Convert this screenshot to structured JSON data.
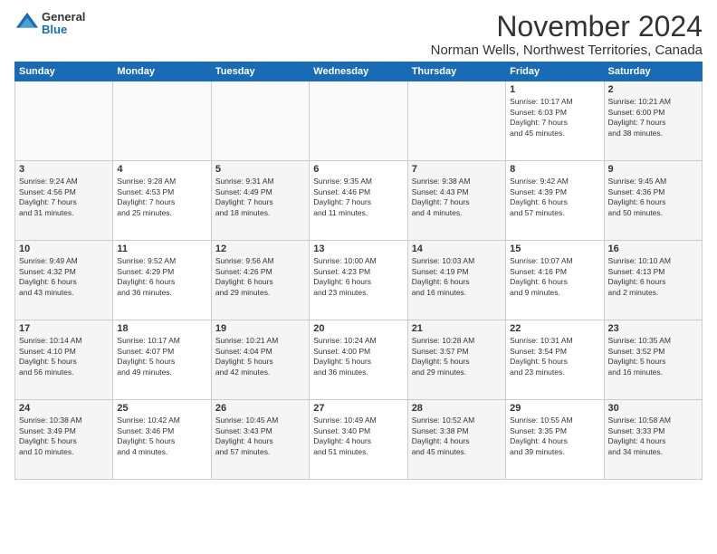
{
  "logo": {
    "general": "General",
    "blue": "Blue"
  },
  "title": "November 2024",
  "subtitle": "Norman Wells, Northwest Territories, Canada",
  "weekdays": [
    "Sunday",
    "Monday",
    "Tuesday",
    "Wednesday",
    "Thursday",
    "Friday",
    "Saturday"
  ],
  "weeks": [
    [
      {
        "day": "",
        "info": ""
      },
      {
        "day": "",
        "info": ""
      },
      {
        "day": "",
        "info": ""
      },
      {
        "day": "",
        "info": ""
      },
      {
        "day": "",
        "info": ""
      },
      {
        "day": "1",
        "info": "Sunrise: 10:17 AM\nSunset: 6:03 PM\nDaylight: 7 hours\nand 45 minutes."
      },
      {
        "day": "2",
        "info": "Sunrise: 10:21 AM\nSunset: 6:00 PM\nDaylight: 7 hours\nand 38 minutes."
      }
    ],
    [
      {
        "day": "3",
        "info": "Sunrise: 9:24 AM\nSunset: 4:56 PM\nDaylight: 7 hours\nand 31 minutes."
      },
      {
        "day": "4",
        "info": "Sunrise: 9:28 AM\nSunset: 4:53 PM\nDaylight: 7 hours\nand 25 minutes."
      },
      {
        "day": "5",
        "info": "Sunrise: 9:31 AM\nSunset: 4:49 PM\nDaylight: 7 hours\nand 18 minutes."
      },
      {
        "day": "6",
        "info": "Sunrise: 9:35 AM\nSunset: 4:46 PM\nDaylight: 7 hours\nand 11 minutes."
      },
      {
        "day": "7",
        "info": "Sunrise: 9:38 AM\nSunset: 4:43 PM\nDaylight: 7 hours\nand 4 minutes."
      },
      {
        "day": "8",
        "info": "Sunrise: 9:42 AM\nSunset: 4:39 PM\nDaylight: 6 hours\nand 57 minutes."
      },
      {
        "day": "9",
        "info": "Sunrise: 9:45 AM\nSunset: 4:36 PM\nDaylight: 6 hours\nand 50 minutes."
      }
    ],
    [
      {
        "day": "10",
        "info": "Sunrise: 9:49 AM\nSunset: 4:32 PM\nDaylight: 6 hours\nand 43 minutes."
      },
      {
        "day": "11",
        "info": "Sunrise: 9:52 AM\nSunset: 4:29 PM\nDaylight: 6 hours\nand 36 minutes."
      },
      {
        "day": "12",
        "info": "Sunrise: 9:56 AM\nSunset: 4:26 PM\nDaylight: 6 hours\nand 29 minutes."
      },
      {
        "day": "13",
        "info": "Sunrise: 10:00 AM\nSunset: 4:23 PM\nDaylight: 6 hours\nand 23 minutes."
      },
      {
        "day": "14",
        "info": "Sunrise: 10:03 AM\nSunset: 4:19 PM\nDaylight: 6 hours\nand 16 minutes."
      },
      {
        "day": "15",
        "info": "Sunrise: 10:07 AM\nSunset: 4:16 PM\nDaylight: 6 hours\nand 9 minutes."
      },
      {
        "day": "16",
        "info": "Sunrise: 10:10 AM\nSunset: 4:13 PM\nDaylight: 6 hours\nand 2 minutes."
      }
    ],
    [
      {
        "day": "17",
        "info": "Sunrise: 10:14 AM\nSunset: 4:10 PM\nDaylight: 5 hours\nand 56 minutes."
      },
      {
        "day": "18",
        "info": "Sunrise: 10:17 AM\nSunset: 4:07 PM\nDaylight: 5 hours\nand 49 minutes."
      },
      {
        "day": "19",
        "info": "Sunrise: 10:21 AM\nSunset: 4:04 PM\nDaylight: 5 hours\nand 42 minutes."
      },
      {
        "day": "20",
        "info": "Sunrise: 10:24 AM\nSunset: 4:00 PM\nDaylight: 5 hours\nand 36 minutes."
      },
      {
        "day": "21",
        "info": "Sunrise: 10:28 AM\nSunset: 3:57 PM\nDaylight: 5 hours\nand 29 minutes."
      },
      {
        "day": "22",
        "info": "Sunrise: 10:31 AM\nSunset: 3:54 PM\nDaylight: 5 hours\nand 23 minutes."
      },
      {
        "day": "23",
        "info": "Sunrise: 10:35 AM\nSunset: 3:52 PM\nDaylight: 5 hours\nand 16 minutes."
      }
    ],
    [
      {
        "day": "24",
        "info": "Sunrise: 10:38 AM\nSunset: 3:49 PM\nDaylight: 5 hours\nand 10 minutes."
      },
      {
        "day": "25",
        "info": "Sunrise: 10:42 AM\nSunset: 3:46 PM\nDaylight: 5 hours\nand 4 minutes."
      },
      {
        "day": "26",
        "info": "Sunrise: 10:45 AM\nSunset: 3:43 PM\nDaylight: 4 hours\nand 57 minutes."
      },
      {
        "day": "27",
        "info": "Sunrise: 10:49 AM\nSunset: 3:40 PM\nDaylight: 4 hours\nand 51 minutes."
      },
      {
        "day": "28",
        "info": "Sunrise: 10:52 AM\nSunset: 3:38 PM\nDaylight: 4 hours\nand 45 minutes."
      },
      {
        "day": "29",
        "info": "Sunrise: 10:55 AM\nSunset: 3:35 PM\nDaylight: 4 hours\nand 39 minutes."
      },
      {
        "day": "30",
        "info": "Sunrise: 10:58 AM\nSunset: 3:33 PM\nDaylight: 4 hours\nand 34 minutes."
      }
    ]
  ]
}
